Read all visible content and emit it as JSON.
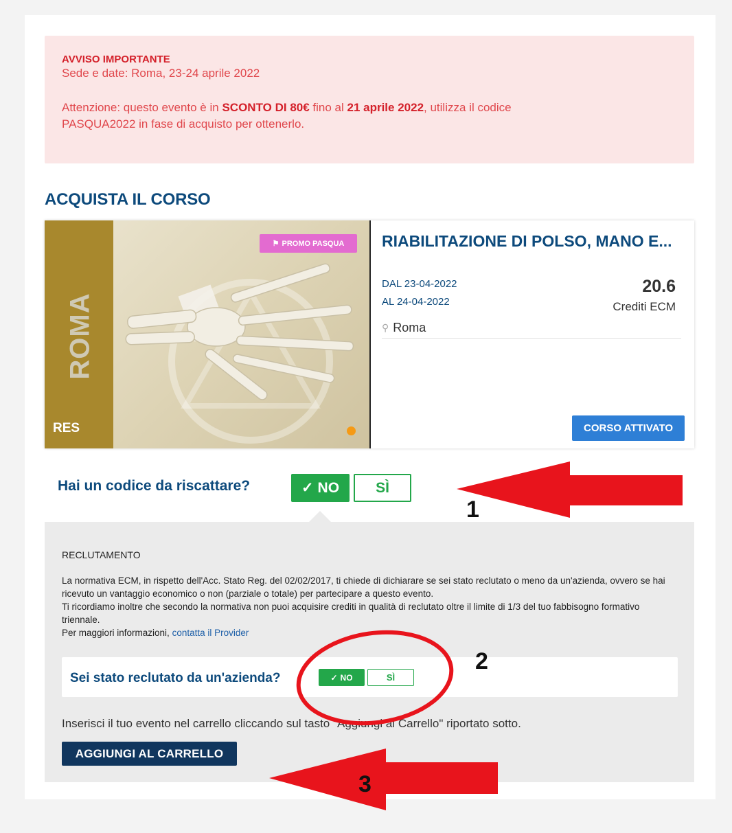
{
  "notice": {
    "title": "AVVISO IMPORTANTE",
    "line1": "Sede e date: Roma, 23-24 aprile 2022",
    "line2_pre": "Attenzione: questo evento è in ",
    "line2_bold1": "SCONTO DI 80€",
    "line2_mid": " fino al ",
    "line2_bold2": "21 aprile 2022",
    "line2_post": ", utilizza il codice",
    "line3": "PASQUA2022 in fase di acquisto per ottenerlo."
  },
  "section_title": "ACQUISTA IL CORSO",
  "course": {
    "city_band": "ROMA",
    "type": "RES",
    "badge": "PROMO PASQUA",
    "name": "RIABILITAZIONE DI POLSO, MANO E...",
    "date_from": "DAL 23-04-2022",
    "date_to": "AL 24-04-2022",
    "credits_value": "20.6",
    "credits_label": "Crediti ECM",
    "location": "Roma",
    "status_button": "CORSO ATTIVATO"
  },
  "code_question": {
    "label": "Hai un codice da riscattare?",
    "no_label": "NO",
    "si_label": "SÌ"
  },
  "recruitment": {
    "title": "RECLUTAMENTO",
    "text_1": "La normativa ECM, in rispetto dell'Acc. Stato Reg. del 02/02/2017, ti chiede di dichiarare se sei stato reclutato o meno da un'azienda, ovvero se hai ricevuto un vantaggio economico o non (parziale o totale) per partecipare a questo evento.",
    "text_2": "Ti ricordiamo inoltre che secondo la normativa non puoi acquisire crediti in qualità di reclutato oltre il limite di 1/3 del tuo fabbisogno formativo triennale.",
    "text_3_pre": "Per maggiori informazioni, ",
    "text_3_link": "contatta il Provider",
    "question": "Sei stato reclutato da un'azienda?",
    "no_label": "NO",
    "si_label": "SÌ"
  },
  "cart": {
    "hint": "Inserisci il tuo evento nel carrello cliccando sul tasto \"Aggiungi al Carrello\" riportato sotto.",
    "button": "AGGIUNGI AL CARRELLO"
  },
  "annotations": {
    "n1": "1",
    "n2": "2",
    "n3": "3"
  },
  "colors": {
    "brand_blue": "#0d4a7c",
    "success_green": "#23a74a",
    "notice_red": "#d4202a",
    "annotation_red": "#e8141c"
  }
}
